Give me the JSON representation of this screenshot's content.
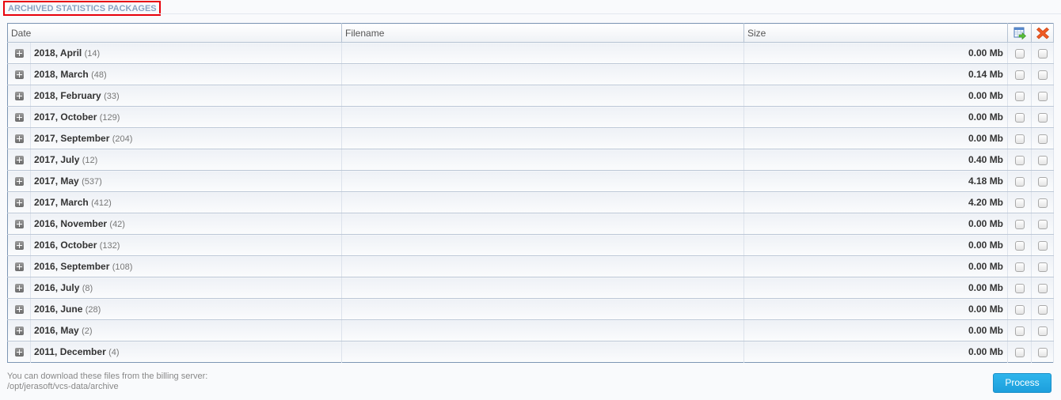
{
  "section": {
    "title": "ARCHIVED STATISTICS PACKAGES"
  },
  "table": {
    "columns": {
      "date": "Date",
      "filename": "Filename",
      "size": "Size",
      "export_icon": "export-icon",
      "delete_icon": "delete-icon"
    },
    "rows": [
      {
        "date": "2018, April",
        "count": "(14)",
        "filename": "",
        "size": "0.00 Mb"
      },
      {
        "date": "2018, March",
        "count": "(48)",
        "filename": "",
        "size": "0.14 Mb"
      },
      {
        "date": "2018, February",
        "count": "(33)",
        "filename": "",
        "size": "0.00 Mb"
      },
      {
        "date": "2017, October",
        "count": "(129)",
        "filename": "",
        "size": "0.00 Mb"
      },
      {
        "date": "2017, September",
        "count": "(204)",
        "filename": "",
        "size": "0.00 Mb"
      },
      {
        "date": "2017, July",
        "count": "(12)",
        "filename": "",
        "size": "0.40 Mb"
      },
      {
        "date": "2017, May",
        "count": "(537)",
        "filename": "",
        "size": "4.18 Mb"
      },
      {
        "date": "2017, March",
        "count": "(412)",
        "filename": "",
        "size": "4.20 Mb"
      },
      {
        "date": "2016, November",
        "count": "(42)",
        "filename": "",
        "size": "0.00 Mb"
      },
      {
        "date": "2016, October",
        "count": "(132)",
        "filename": "",
        "size": "0.00 Mb"
      },
      {
        "date": "2016, September",
        "count": "(108)",
        "filename": "",
        "size": "0.00 Mb"
      },
      {
        "date": "2016, July",
        "count": "(8)",
        "filename": "",
        "size": "0.00 Mb"
      },
      {
        "date": "2016, June",
        "count": "(28)",
        "filename": "",
        "size": "0.00 Mb"
      },
      {
        "date": "2016, May",
        "count": "(2)",
        "filename": "",
        "size": "0.00 Mb"
      },
      {
        "date": "2011, December",
        "count": "(4)",
        "filename": "",
        "size": "0.00 Mb"
      }
    ]
  },
  "footer": {
    "note_line1": "You can download these files from the billing server:",
    "note_line2": "/opt/jerasoft/vcs-data/archive",
    "process_label": "Process"
  },
  "colors": {
    "title_text": "#8aa3c2",
    "title_border": "#e8000b",
    "button_bg": "#1d9fdc"
  }
}
